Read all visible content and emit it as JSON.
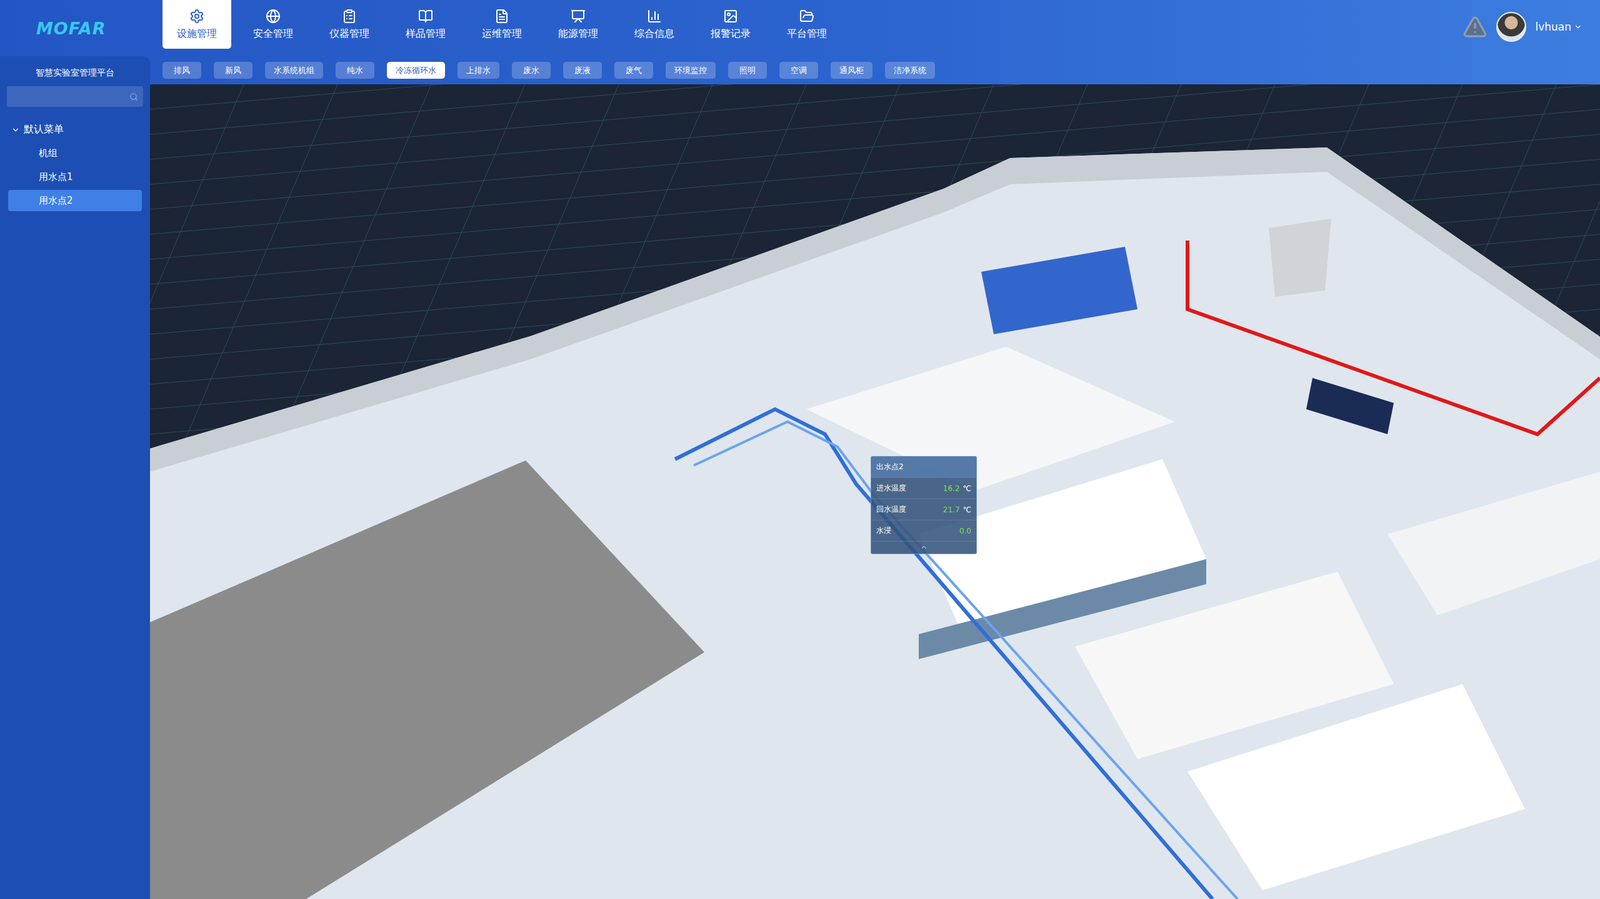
{
  "logo": "MOFAR",
  "nav": [
    {
      "label": "设施管理",
      "selected": true
    },
    {
      "label": "安全管理",
      "selected": false
    },
    {
      "label": "仪器管理",
      "selected": false
    },
    {
      "label": "样品管理",
      "selected": false
    },
    {
      "label": "运维管理",
      "selected": false
    },
    {
      "label": "能源管理",
      "selected": false
    },
    {
      "label": "综合信息",
      "selected": false
    },
    {
      "label": "报警记录",
      "selected": false
    },
    {
      "label": "平台管理",
      "selected": false
    }
  ],
  "user": {
    "name": "lvhuan"
  },
  "sidebar": {
    "title": "智慧实验室管理平台",
    "tree": {
      "label": "默认菜单",
      "expanded": true,
      "items": [
        {
          "label": "机组",
          "selected": false
        },
        {
          "label": "用水点1",
          "selected": false
        },
        {
          "label": "用水点2",
          "selected": true
        }
      ]
    }
  },
  "subtabs": [
    {
      "label": "排风",
      "selected": false
    },
    {
      "label": "新风",
      "selected": false
    },
    {
      "label": "水系统机组",
      "selected": false
    },
    {
      "label": "纯水",
      "selected": false
    },
    {
      "label": "冷冻循环水",
      "selected": true
    },
    {
      "label": "上排水",
      "selected": false
    },
    {
      "label": "废水",
      "selected": false
    },
    {
      "label": "废液",
      "selected": false
    },
    {
      "label": "废气",
      "selected": false
    },
    {
      "label": "环境监控",
      "selected": false
    },
    {
      "label": "照明",
      "selected": false
    },
    {
      "label": "空调",
      "selected": false
    },
    {
      "label": "通风柜",
      "selected": false
    },
    {
      "label": "洁净系统",
      "selected": false
    }
  ],
  "scene": {
    "tooltip": {
      "title": "出水点2",
      "expanded": true,
      "rows": [
        {
          "label": "进水温度",
          "value": "16.2",
          "unit": "℃"
        },
        {
          "label": "回水温度",
          "value": "21.7",
          "unit": "℃"
        },
        {
          "label": "水浸",
          "value": "0.0",
          "unit": ""
        }
      ]
    }
  }
}
